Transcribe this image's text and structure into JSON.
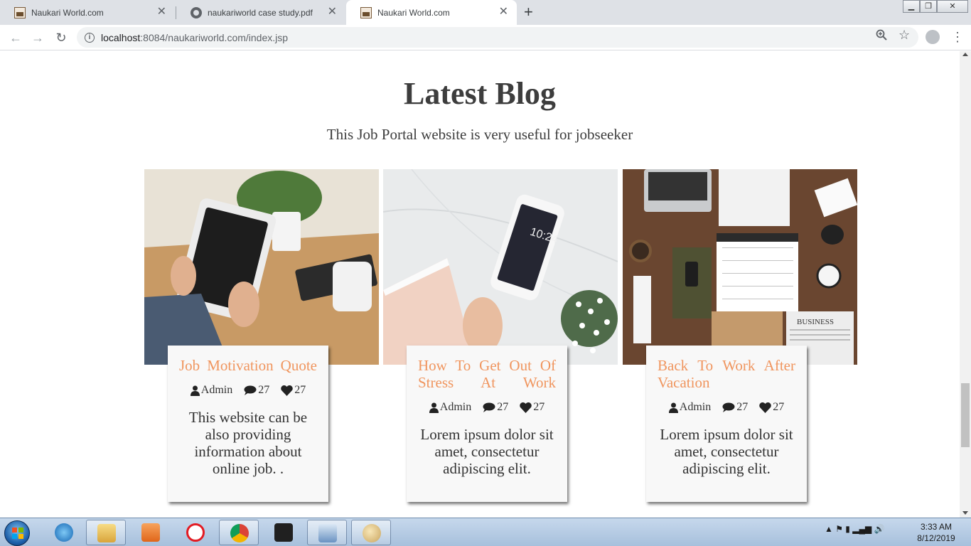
{
  "browser": {
    "tabs": [
      {
        "title": "Naukari World.com",
        "favicon": "site-icon",
        "active": false
      },
      {
        "title": "naukariworld case study.pdf",
        "favicon": "globe-icon",
        "active": false
      },
      {
        "title": "Naukari World.com",
        "favicon": "site-icon",
        "active": true
      }
    ],
    "url_host": "localhost",
    "url_rest": ":8084/naukariworld.com/index.jsp"
  },
  "section": {
    "title": "Latest Blog",
    "subtitle": "This Job Portal website is very useful for jobseeker"
  },
  "posts": [
    {
      "title": "Job Motivation Quote",
      "author": "Admin",
      "comments": "27",
      "likes": "27",
      "excerpt": "This website can be also providing information about online job. .",
      "image": "tablet-desk-photo"
    },
    {
      "title": "How To Get Out Of Stress At Work",
      "author": "Admin",
      "comments": "27",
      "likes": "27",
      "excerpt": "Lorem ipsum dolor sit amet, consectetur adipiscing elit.",
      "image": "phone-marble-photo"
    },
    {
      "title": "Back To Work After Vacation",
      "author": "Admin",
      "comments": "27",
      "likes": "27",
      "excerpt": "Lorem ipsum dolor sit amet, consectetur adipiscing elit.",
      "image": "planner-desk-photo"
    }
  ],
  "taskbar": {
    "time": "3:33 AM",
    "date": "8/12/2019"
  },
  "colors": {
    "accent": "#f0955e",
    "heading": "#3d3d3d"
  }
}
